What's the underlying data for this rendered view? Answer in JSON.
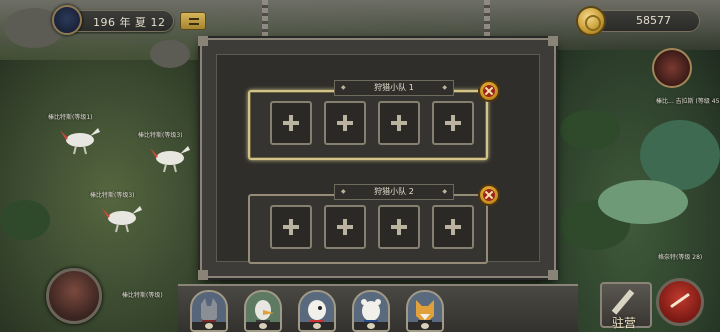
{
  "hud": {
    "date": "196 年 夏 12",
    "gold": "58577"
  },
  "map_labels": {
    "creature_1": "榛比特斯(等级1)",
    "creature_2": "榛比特斯(等级3)",
    "creature_3": "榛比特斯(等级3)",
    "creature_4": "榛比特斯(等级)",
    "boss": "榛比... 吉拉斯 (等级 45)",
    "dragon": "格奈特(等级 28)"
  },
  "hunting": {
    "teams": [
      {
        "title": "狩猎小队 1",
        "slots": 4,
        "active": true
      },
      {
        "title": "狩猎小队 2",
        "slots": 4,
        "active": false
      }
    ]
  },
  "bottom": {
    "camp_label": "驻营",
    "portraits": [
      "wolf-avatar",
      "bird-avatar",
      "white-bird-avatar",
      "polar-bear-avatar",
      "fox-avatar"
    ]
  },
  "colors": {
    "accent_gold": "#d3c58a",
    "close_red": "#9c2418"
  }
}
